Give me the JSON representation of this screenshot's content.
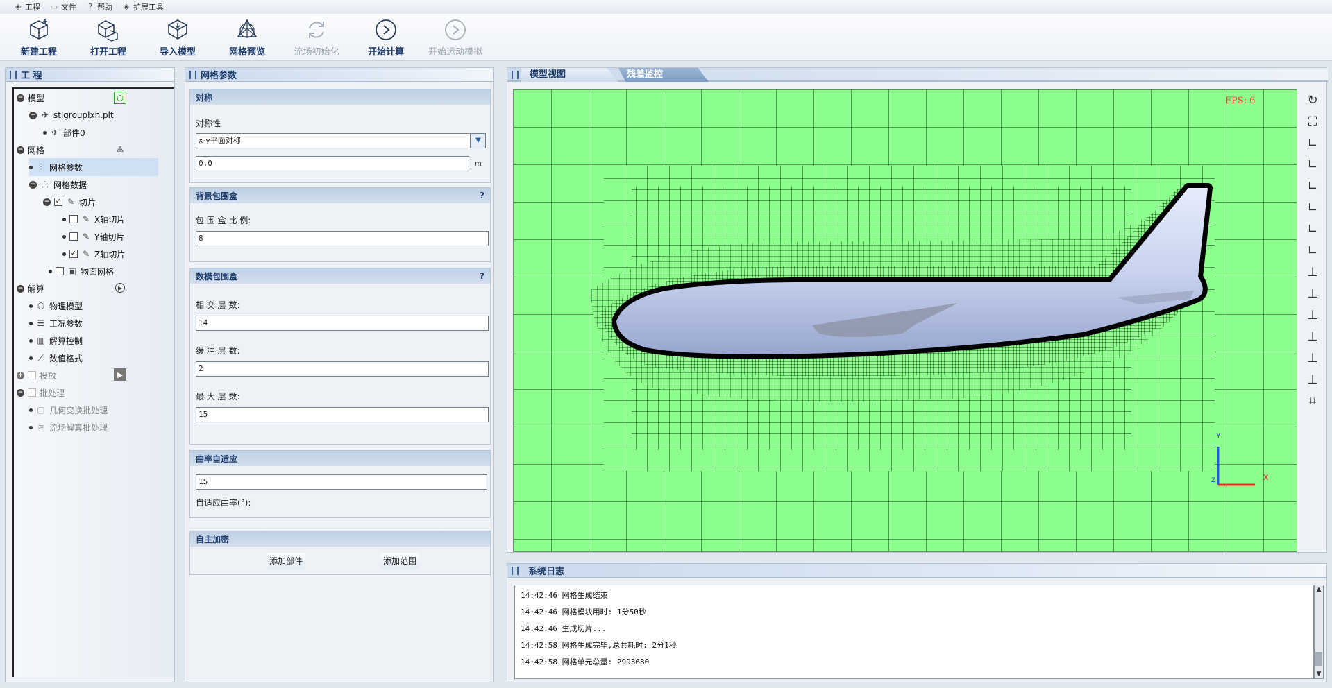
{
  "menu": [
    {
      "icon": "layers-icon",
      "label": "工程"
    },
    {
      "icon": "folder-icon",
      "label": "文件"
    },
    {
      "icon": "help-icon",
      "label": "帮助"
    },
    {
      "icon": "layers-icon",
      "label": "扩展工具"
    }
  ],
  "toolbar": [
    {
      "icon": "new-project-cube-icon",
      "label": "新建工程",
      "enabled": true
    },
    {
      "icon": "open-project-cubes-icon",
      "label": "打开工程",
      "enabled": true
    },
    {
      "icon": "import-model-icon",
      "label": "导入模型",
      "enabled": true
    },
    {
      "icon": "mesh-preview-icon",
      "label": "网格预览",
      "enabled": true
    },
    {
      "icon": "refresh-icon",
      "label": "流场初始化",
      "enabled": false
    },
    {
      "icon": "play-icon",
      "label": "开始计算",
      "enabled": true
    },
    {
      "icon": "play-icon",
      "label": "开始运动模拟",
      "enabled": false
    }
  ],
  "project_panel": {
    "title": "工 程",
    "tree": [
      {
        "label": "模型",
        "level": 0,
        "toggle": "−"
      },
      {
        "label": "stlgrouplxh.plt",
        "level": 1,
        "toggle": "−",
        "icon": "plane-icon"
      },
      {
        "label": "部件0",
        "level": 2,
        "icon": "plane-icon"
      },
      {
        "label": "网格",
        "level": 0,
        "toggle": "−"
      },
      {
        "label": "网格参数",
        "level": 1,
        "icon": "sliders-icon",
        "selected": true
      },
      {
        "label": "网格数据",
        "level": 1,
        "toggle": "−",
        "icon": "nodes-icon"
      },
      {
        "label": "切片",
        "level": 2,
        "toggle": "−",
        "checkbox": true,
        "checked": true,
        "icon": "pen-icon"
      },
      {
        "label": "X轴切片",
        "level": 3,
        "checkbox": true,
        "checked": false,
        "icon": "pen-icon"
      },
      {
        "label": "Y轴切片",
        "level": 3,
        "checkbox": true,
        "checked": false,
        "icon": "pen-icon"
      },
      {
        "label": "Z轴切片",
        "level": 3,
        "checkbox": true,
        "checked": true,
        "icon": "pen-icon"
      },
      {
        "label": "物面网格",
        "level": 2,
        "checkbox": true,
        "checked": false,
        "icon": "surface-mesh-icon"
      },
      {
        "label": "解算",
        "level": 0,
        "toggle": "−"
      },
      {
        "label": "物理模型",
        "level": 1,
        "icon": "cube-icon"
      },
      {
        "label": "工况参数",
        "level": 1,
        "icon": "form-icon"
      },
      {
        "label": "解算控制",
        "level": 1,
        "icon": "control-icon"
      },
      {
        "label": "数值格式",
        "level": 1,
        "icon": "chart-icon"
      },
      {
        "label": "投放",
        "level": 0,
        "toggle": "+",
        "checkbox": true,
        "checked": false,
        "disabled": true
      },
      {
        "label": "批处理",
        "level": 0,
        "toggle": "−",
        "checkbox": true,
        "checked": false,
        "disabled": true
      },
      {
        "label": "几何变换批处理",
        "level": 1,
        "icon": "geometry-icon",
        "disabled": true
      },
      {
        "label": "流场解算批处理",
        "level": 1,
        "icon": "waves-icon",
        "disabled": true
      }
    ]
  },
  "mesh_panel": {
    "title": "网格参数",
    "symmetry": {
      "header": "对称",
      "label": "对称性",
      "select_value": "x-y平面对称",
      "value": "0.0",
      "unit": "m"
    },
    "bg_box": {
      "header": "背景包围盒",
      "help": "?",
      "label": "包 围 盒 比 例:",
      "value": "8"
    },
    "model_box": {
      "header": "数模包围盒",
      "help": "?",
      "intersect_label": "相 交 层 数:",
      "intersect_value": "14",
      "buffer_label": "缓 冲 层 数:",
      "buffer_value": "2",
      "max_label": "最 大 层 数:",
      "max_value": "15"
    },
    "curvature": {
      "header": "曲率自适应",
      "value": "15",
      "label": "自适应曲率(°):"
    },
    "refine": {
      "header": "自主加密",
      "add_part": "添加部件",
      "add_range": "添加范围"
    }
  },
  "view_panel": {
    "tabs": [
      "模型视图",
      "残差监控"
    ],
    "active_tab": 0,
    "fps": "FPS: 6",
    "axis_y": "Y",
    "axis_x": "X",
    "axis_z": "Z",
    "background_color": "#8dff8d",
    "side_tools": [
      "rotate-icon",
      "fit-icon",
      "view-30-icon",
      "view-30b-icon",
      "view-30c-icon",
      "view-90-icon",
      "view-90b-icon",
      "view-90c-icon",
      "axis-x-icon",
      "axis-y-icon",
      "axis-z-icon",
      "axis-zb-icon",
      "axis-xb-icon",
      "axis-yb-icon",
      "crop-icon"
    ]
  },
  "log_panel": {
    "title": "系统日志",
    "lines": [
      {
        "time": "14:42:46",
        "text": "网格生成结束"
      },
      {
        "time": "14:42:46",
        "text": "网格模块用时: 1分50秒"
      },
      {
        "time": "14:42:46",
        "text": "生成切片..."
      },
      {
        "time": "14:42:58",
        "text": "网格生成完毕,总共耗时: 2分1秒"
      },
      {
        "time": "14:42:58",
        "text": "网格单元总量: 2993680"
      }
    ]
  }
}
